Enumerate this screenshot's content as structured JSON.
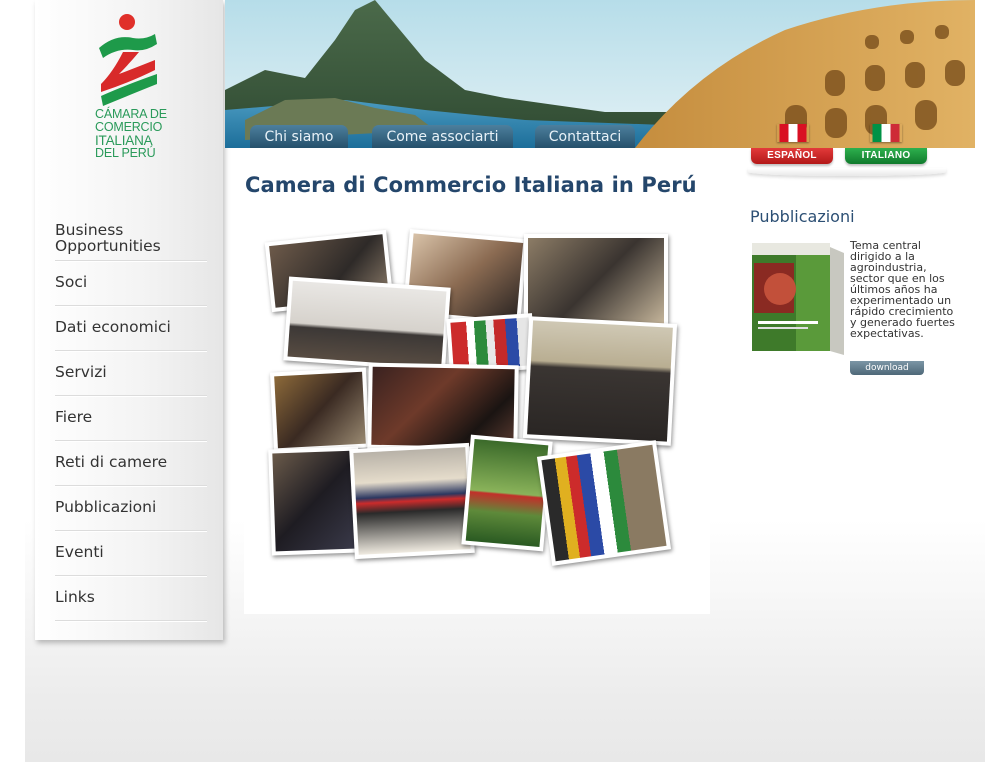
{
  "logo": {
    "lines": [
      "CÁMARA DE",
      "COMERCIO",
      "ITALIANA",
      "DEL PERÚ"
    ]
  },
  "header": {
    "tabs": [
      {
        "label": "Chi siamo"
      },
      {
        "label": "Come associarti"
      },
      {
        "label": "Contattaci"
      }
    ],
    "languages": [
      {
        "label": "ESPAÑOL",
        "color": "#c8202a"
      },
      {
        "label": "ITALIANO",
        "color": "#14913a"
      }
    ]
  },
  "sidebar": {
    "items": [
      {
        "label": "Business Opportunities"
      },
      {
        "label": "Soci"
      },
      {
        "label": "Dati economici"
      },
      {
        "label": "Servizi"
      },
      {
        "label": "Fiere"
      },
      {
        "label": "Reti di camere"
      },
      {
        "label": "Pubblicazioni"
      },
      {
        "label": "Eventi"
      },
      {
        "label": "Links"
      }
    ]
  },
  "main": {
    "title": "Camera di Commercio Italiana in Perú"
  },
  "publications": {
    "title": "Pubblicazioni",
    "description": "Tema central dirigido a la agroindustria, sector que en los últimos años ha experimentado un rápido crecimiento y generado fuertes expectativas.",
    "download_label": "download"
  },
  "colors": {
    "brand_green": "#2a9a5a",
    "brand_red": "#d62a2a",
    "title_blue": "#24466b",
    "tab_blue": "#2e5a76"
  }
}
